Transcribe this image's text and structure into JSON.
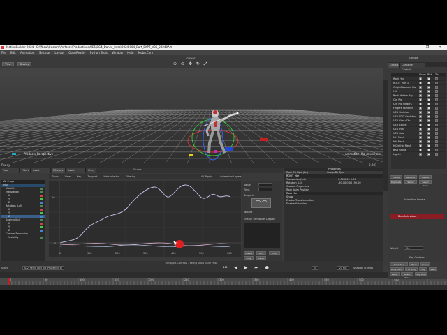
{
  "window": {
    "title": "MotionBuilder 2024 - E:\\Wioul\\Custom\\Perforce\\Productions\\UE5\\BG4_Dance_Intro\\2024.004_Barf_EXPT_V06_20240Art",
    "controls": "– ❐ ✕"
  },
  "menu": [
    "File",
    "Edit",
    "Animation",
    "Settings",
    "Layout",
    "OpenReality",
    "Python Tools",
    "Window",
    "Help",
    "Mobu.Core"
  ],
  "viewer": {
    "title": "Viewer",
    "view_btn": "View",
    "display_btn": "Display",
    "tools": "⊕ ⊙ ✥ ↻ ⤢",
    "camera_label": "Producer Perspective",
    "camera_label_right": "Animation: Ua_mixed Jaw",
    "status_left": "Ready",
    "status_right": "0.287"
  },
  "fcurve": {
    "header": "FCurve",
    "tabs": [
      "Pose Controls",
      "Filters",
      "Asset Browser",
      "FCurves",
      "Asset Settings",
      "Story"
    ],
    "graph_header": [
      "Show",
      "View",
      "Key",
      "Tangent",
      "Interpolation",
      "Filtering"
    ],
    "toolbar_right": [
      "All Ripple",
      "Animation Layers"
    ],
    "nav_title": "All Props",
    "nav_items": [
      "root",
      "Visibility",
      "Translation",
      "X",
      "Y",
      "Z",
      "Rotation (Lcl)",
      "X",
      "Y",
      "Z",
      "Scaling (Lcl)",
      "X",
      "Y",
      "Z",
      "Custom Properties",
      "Visibility"
    ],
    "x_ticks": [
      "0",
      "100",
      "200",
      "300",
      "400",
      "500",
      "600"
    ],
    "y_ticks": [
      "50",
      "0"
    ],
    "key_panel": {
      "value_label": "Value",
      "time_label": "Time",
      "tangent_label": "Tangent",
      "weight_label": "Weight",
      "enable_tangent": "Enable Timeshifts Display",
      "buttons": [
        "Create",
        "Lock",
        "Unroll",
        "Snap",
        "Bezier"
      ]
    }
  },
  "properties": {
    "title": "Properties",
    "header_left": "Root CS Hips (Lcl)",
    "header_right": "Group By Type",
    "rows": [
      {
        "label": "ROOT_Hbr",
        "value": "",
        "section": true
      },
      {
        "label": "Translation (Lcl)",
        "value": "0.00   0.00   0.00"
      },
      {
        "label": "Rotation (Lcl)",
        "value": "-90.00   0.00   -90.00"
      },
      {
        "label": "Custom Properties",
        "value": ""
      },
      {
        "label": "Root Anim Position",
        "value": ""
      },
      {
        "label": "Root Hbr",
        "value": "",
        "section": true
      },
      {
        "label": "Show",
        "value": ""
      },
      {
        "label": "Enable Transformation",
        "value": ""
      },
      {
        "label": "Enable Selection",
        "value": ""
      }
    ]
  },
  "right_panel": {
    "header": "Groups",
    "tabs": [
      "Groups",
      "Character Controls"
    ],
    "col_headers": [
      "Show",
      "Pick",
      "Trs"
    ],
    "items": [
      "Root Hbr",
      "ROOT_Hbr_1",
      "OriginMeasure Hbr",
      "HH",
      "Root Motion Rig",
      "Ctrl Rig",
      "Ctrl Rig Fingers",
      "Fingers Skeleton",
      "UE4 Skeleton",
      "UE4 EDIT Skeleton",
      "UE4 Char-rCtr",
      "UE4 Export",
      "UE4 mm",
      "UE4 Geo",
      "MH Mesh",
      "MH Mesh",
      "MCtrl hid Mesh",
      "BAB Group",
      "Lights"
    ],
    "buttons": [
      "Create",
      "Rename",
      "Delete",
      "Duplicate",
      "Select",
      "Select None",
      "Merge",
      "Unselect"
    ],
    "anim_layer_title": "Animation Layers",
    "anim_layer_name": "BaseAnimation",
    "weight_label": "Weight",
    "weight_value": "100",
    "key_controls": "Key Controls",
    "right_btns": [
      "Animation",
      "Trans",
      "Rotate",
      "Body Parts",
      "Full Body",
      "Key",
      "Zero",
      "Reset",
      "Reset Pose",
      "Key Pose"
    ]
  },
  "transport": {
    "title": "Transport Controls - Young show Anim Pose",
    "take_label": "Story",
    "take_value": "A02_Perfo_Jam_V8_Properlet_M",
    "speed": "1x",
    "fps_value": "24 fps",
    "frame_value": "0",
    "snap_label": "Snap on Frames",
    "ruler_ticks": [
      "0",
      "50",
      "100",
      "150",
      "200",
      "250",
      "300",
      "350",
      "400",
      "450",
      "500",
      "550"
    ]
  }
}
